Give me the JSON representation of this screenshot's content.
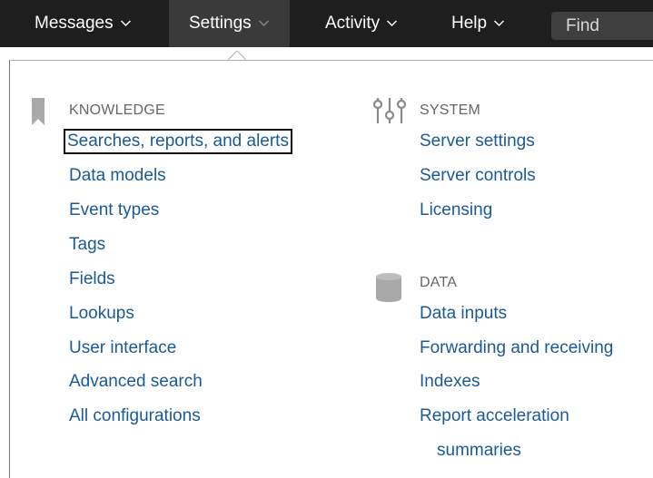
{
  "nav": {
    "items": [
      {
        "label": "Messages"
      },
      {
        "label": "Settings"
      },
      {
        "label": "Activity"
      },
      {
        "label": "Help"
      }
    ],
    "find_placeholder": "Find"
  },
  "knowledge": {
    "heading": "KNOWLEDGE",
    "icon": "bookmark-icon",
    "links": [
      "Searches, reports, and alerts",
      "Data models",
      "Event types",
      "Tags",
      "Fields",
      "Lookups",
      "User interface",
      "Advanced search",
      "All configurations"
    ]
  },
  "system": {
    "heading": "SYSTEM",
    "icon": "sliders-icon",
    "links": [
      "Server settings",
      "Server controls",
      "Licensing"
    ]
  },
  "data": {
    "heading": "DATA",
    "icon": "database-icon",
    "links": [
      "Data inputs",
      "Forwarding and receiving",
      "Indexes",
      "Report acceleration",
      "summaries"
    ]
  },
  "colors": {
    "topbar": "#1e1e1e",
    "active_tab": "#3a3a3a",
    "link": "#1a5a96",
    "heading": "#666666"
  }
}
